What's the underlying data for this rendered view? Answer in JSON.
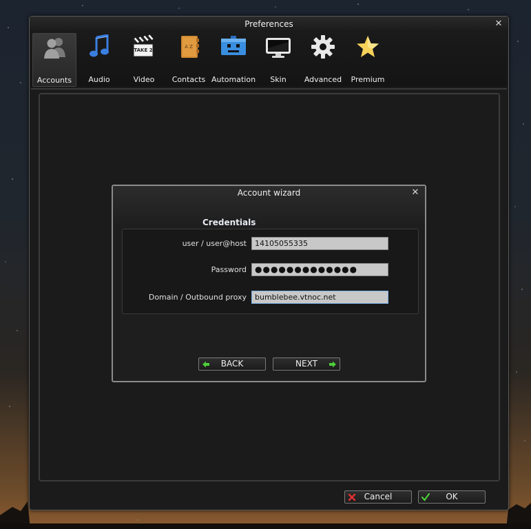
{
  "window": {
    "title": "Preferences"
  },
  "toolbar": {
    "items": [
      {
        "label": "Accounts",
        "icon": "users-icon",
        "active": true
      },
      {
        "label": "Audio",
        "icon": "music-note-icon"
      },
      {
        "label": "Video",
        "icon": "clapperboard-icon"
      },
      {
        "label": "Contacts",
        "icon": "address-book-icon"
      },
      {
        "label": "Automation",
        "icon": "robot-icon"
      },
      {
        "label": "Skin",
        "icon": "monitor-icon"
      },
      {
        "label": "Advanced",
        "icon": "gear-icon"
      },
      {
        "label": "Premium",
        "icon": "star-icon"
      }
    ],
    "clapper_text": "TAKE 2",
    "book_letters": "A Z"
  },
  "wizard": {
    "title": "Account wizard",
    "section_title": "Credentials",
    "fields": {
      "user": {
        "label": "user / user@host",
        "value": "14105055335"
      },
      "password": {
        "label": "Password",
        "value": "●●●●●●●●●●●●●"
      },
      "domain": {
        "label": "Domain / Outbound proxy",
        "value": "bumblebee.vtnoc.net"
      }
    },
    "back_label": "BACK",
    "next_label": "NEXT"
  },
  "footer": {
    "cancel_label": "Cancel",
    "ok_label": "OK"
  },
  "colors": {
    "accent_green": "#4ccf3a",
    "cancel_red": "#e03030",
    "star_yellow": "#f6d25a",
    "field_focus": "#7ab0e8"
  }
}
